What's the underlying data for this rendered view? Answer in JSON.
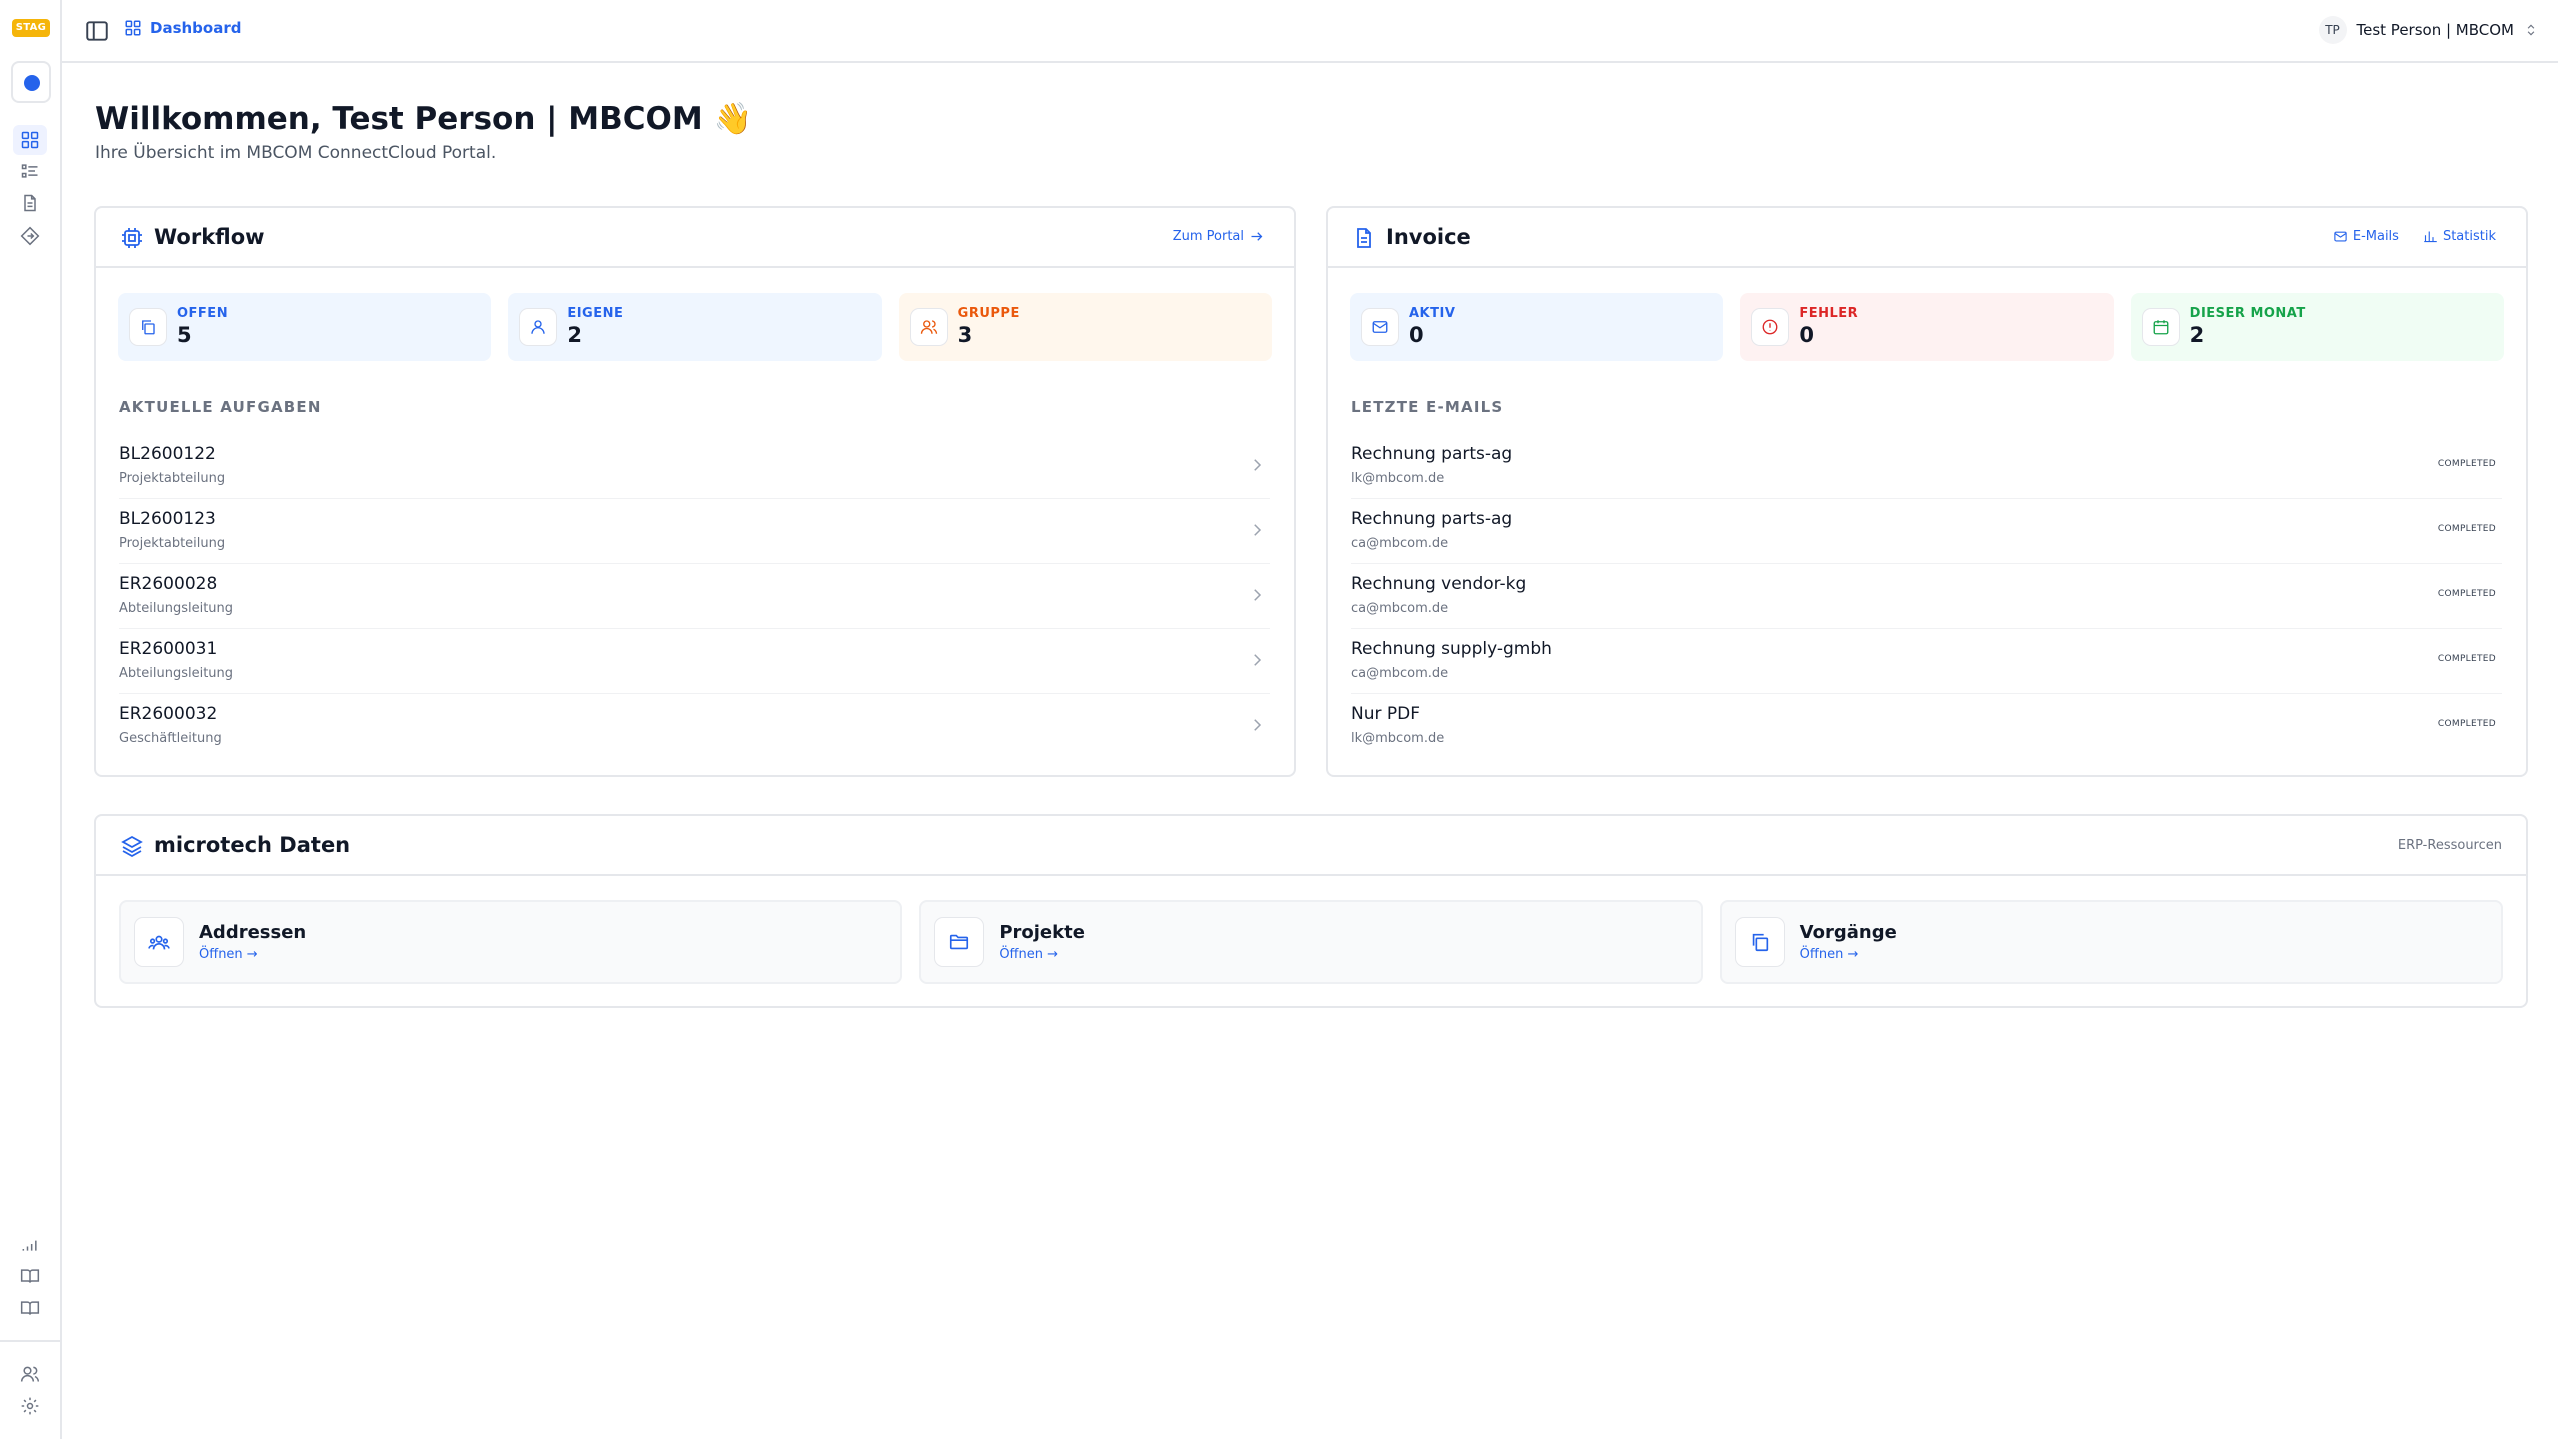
{
  "app": {
    "env_badge": "STAG"
  },
  "topbar": {
    "breadcrumb": "Dashboard",
    "user_initials": "TP",
    "user_name": "Test Person | MBCOM"
  },
  "welcome": {
    "title": "Willkommen, Test Person | MBCOM 👋",
    "subtitle": "Ihre Übersicht im MBCOM ConnectCloud Portal."
  },
  "workflow": {
    "title": "Workflow",
    "portal_link": "Zum Portal",
    "stats": [
      {
        "label": "OFFEN",
        "value": "5"
      },
      {
        "label": "EIGENE",
        "value": "2"
      },
      {
        "label": "GRUPPE",
        "value": "3"
      }
    ],
    "section_label": "AKTUELLE AUFGABEN",
    "tasks": [
      {
        "id": "BL2600122",
        "dept": "Projektabteilung"
      },
      {
        "id": "BL2600123",
        "dept": "Projektabteilung"
      },
      {
        "id": "ER2600028",
        "dept": "Abteilungsleitung"
      },
      {
        "id": "ER2600031",
        "dept": "Abteilungsleitung"
      },
      {
        "id": "ER2600032",
        "dept": "Geschäftleitung"
      }
    ]
  },
  "invoice": {
    "title": "Invoice",
    "link_emails": "E-Mails",
    "link_stats": "Statistik",
    "stats": [
      {
        "label": "AKTIV",
        "value": "0"
      },
      {
        "label": "FEHLER",
        "value": "0"
      },
      {
        "label": "DIESER MONAT",
        "value": "2"
      }
    ],
    "section_label": "LETZTE E-MAILS",
    "emails": [
      {
        "subject": "Rechnung parts-ag",
        "from": "lk@mbcom.de",
        "status": "COMPLETED"
      },
      {
        "subject": "Rechnung parts-ag",
        "from": "ca@mbcom.de",
        "status": "COMPLETED"
      },
      {
        "subject": "Rechnung vendor-kg",
        "from": "ca@mbcom.de",
        "status": "COMPLETED"
      },
      {
        "subject": "Rechnung supply-gmbh",
        "from": "ca@mbcom.de",
        "status": "COMPLETED"
      },
      {
        "subject": "Nur PDF",
        "from": "lk@mbcom.de",
        "status": "COMPLETED"
      }
    ]
  },
  "microtech": {
    "title": "microtech Daten",
    "resources_label": "ERP-Ressourcen",
    "tiles": [
      {
        "name": "Addressen",
        "open": "Öffnen →"
      },
      {
        "name": "Projekte",
        "open": "Öffnen →"
      },
      {
        "name": "Vorgänge",
        "open": "Öffnen →"
      }
    ]
  }
}
